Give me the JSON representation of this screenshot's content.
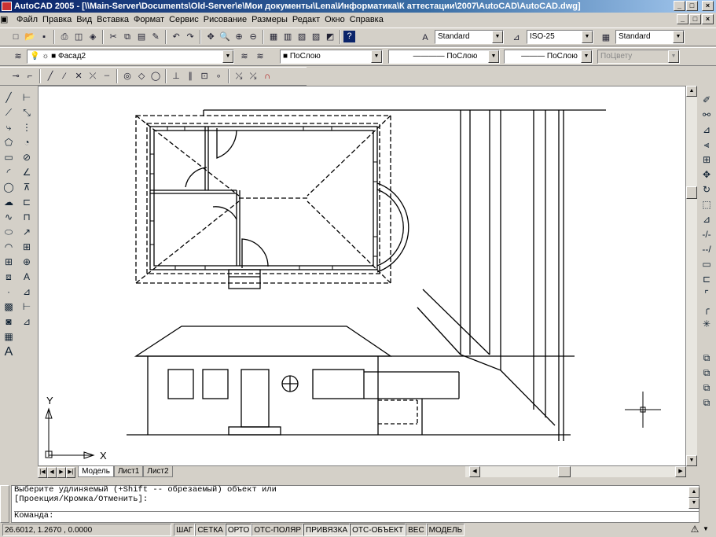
{
  "window": {
    "title": "AutoCAD 2005 - [\\\\Main-Server\\Documents\\Old-Server\\e\\Мои документы\\Lena\\Информатика\\К аттестации\\2007\\AutoCAD\\AutoCAD.dwg]"
  },
  "menu": [
    "Файл",
    "Правка",
    "Вид",
    "Вставка",
    "Формат",
    "Сервис",
    "Рисование",
    "Размеры",
    "Редакт",
    "Окно",
    "Справка"
  ],
  "toolbar": {
    "text_style": "Standard",
    "dim_style": "ISO-25",
    "table_style": "Standard",
    "layer": "Фасад2",
    "color": "ПоСлою",
    "linetype": "ПоСлою",
    "lineweight": "ПоСлою",
    "plotstyle": "ПоЦвету"
  },
  "ucs": {
    "x_label": "X",
    "y_label": "Y"
  },
  "tabs": {
    "model": "Модель",
    "sheet1": "Лист1",
    "sheet2": "Лист2"
  },
  "command": {
    "line1": "Выберите удлиняемый (+Shift -- обрезаемый) объект или",
    "line2": "[Проекция/Кромка/Отменить]:",
    "prompt": "Команда:"
  },
  "status": {
    "coords": "26.6012, 1.2670 , 0.0000",
    "buttons": [
      "ШАГ",
      "СЕТКА",
      "ОРТО",
      "ОТС-ПОЛЯР",
      "ПРИВЯЗКА",
      "ОТС-ОБЪЕКТ",
      "ВЕС",
      "МОДЕЛЬ"
    ]
  },
  "icons": {
    "title": "autocad-logo-icon"
  }
}
